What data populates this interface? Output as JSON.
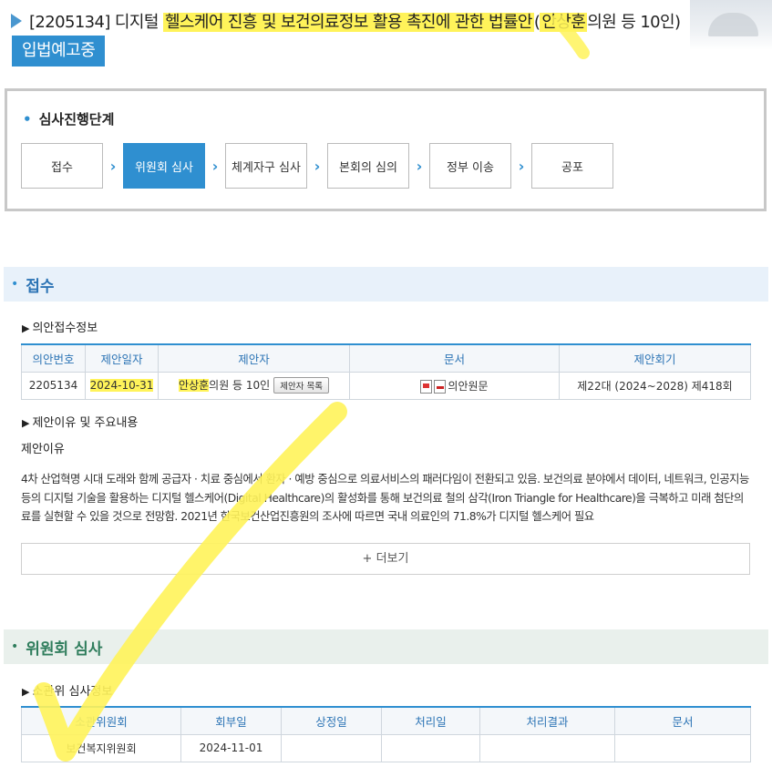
{
  "header": {
    "title_pre": "[2205134] 디지털 ",
    "title_hl": "헬스케어 진흥 및 보건의료정보 활용 촉진에 관한 법률안",
    "title_mid": "(",
    "title_hl2": "안상훈",
    "title_post": "의원 등 10인)",
    "status_badge": "입법예고중"
  },
  "progress": {
    "title": "심사진행단계",
    "steps": [
      "접수",
      "위원회 심사",
      "체계자구 심사",
      "본회의 심의",
      "정부 이송",
      "공포"
    ],
    "active_step": "위원회 심사"
  },
  "section_receipt": {
    "title": "접수",
    "subtitle": "의안접수정보",
    "headers": [
      "의안번호",
      "제안일자",
      "제안자",
      "문서",
      "제안회기"
    ],
    "row": {
      "bill_no": "2205134",
      "date": "2024-10-31",
      "proposer_hl": "안상훈",
      "proposer_rest": "의원 등 10인",
      "proposer_btn": "제안자 목록",
      "doc": "의안원문",
      "session": "제22대 (2024~2028) 제418회"
    },
    "reason_subtitle": "제안이유 및 주요내용",
    "reason_label": "제안이유",
    "reason_text": "4차 산업혁명 시대 도래와 함께 공급자 · 치료 중심에서 환자 · 예방 중심으로 의료서비스의 패러다임이 전환되고 있음. 보건의료 분야에서 데이터, 네트워크, 인공지능 등의 디지털 기술을 활용하는 디지털 헬스케어(Digital Healthcare)의 활성화를 통해 보건의료 철의 삼각(Iron Triangle for Healthcare)을 극복하고 미래 첨단의료를 실현할 수 있을 것으로 전망함. 2021년 한국보건산업진흥원의 조사에 따르면 국내 의료인의 71.8%가 디지털 헬스케어 필요",
    "more_button": "+ 더보기"
  },
  "section_committee": {
    "title": "위원회 심사",
    "subtitle": "소관위 심사정보",
    "headers": [
      "소관위원회",
      "회부일",
      "상정일",
      "처리일",
      "처리결과",
      "문서"
    ],
    "row": [
      "보건복지위원회",
      "2024-11-01",
      "",
      "",
      "",
      ""
    ]
  },
  "colors": {
    "accent": "#2f8fd0",
    "highlighter": "#fff35a",
    "section_bg": "#e8f1fa"
  },
  "icons": {
    "title_arrow": "chevron-right-icon",
    "hwp": "hwp-file-icon",
    "pdf": "pdf-file-icon"
  }
}
